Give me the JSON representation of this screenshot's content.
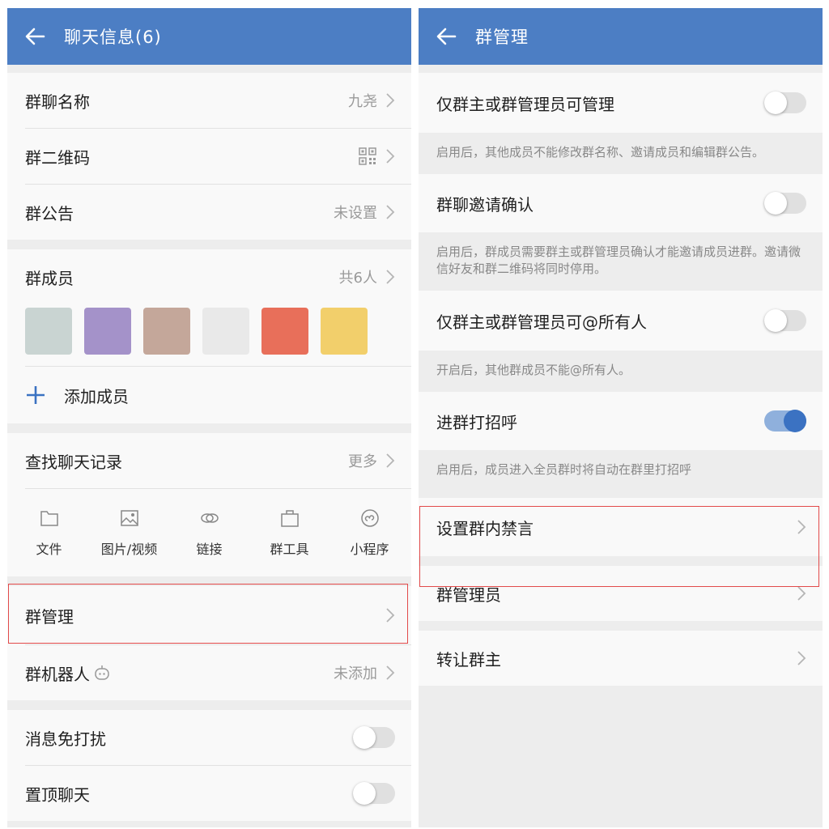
{
  "left": {
    "title": "聊天信息(6)",
    "group_name": {
      "label": "群聊名称",
      "value": "九尧"
    },
    "qrcode": {
      "label": "群二维码"
    },
    "notice": {
      "label": "群公告",
      "value": "未设置"
    },
    "members": {
      "label": "群成员",
      "value": "共6人",
      "add_label": "添加成员",
      "avatar_colors": [
        "#c9d4d2",
        "#a492c9",
        "#c4a79a",
        "#e9e9e9",
        "#e86f5a",
        "#f2cf6b"
      ]
    },
    "search": {
      "label": "查找聊天记录",
      "value": "更多"
    },
    "tools": [
      {
        "label": "文件",
        "icon": "folder-icon"
      },
      {
        "label": "图片/视频",
        "icon": "image-icon"
      },
      {
        "label": "链接",
        "icon": "link-icon"
      },
      {
        "label": "群工具",
        "icon": "toolbox-icon"
      },
      {
        "label": "小程序",
        "icon": "miniprogram-icon"
      }
    ],
    "manage": {
      "label": "群管理"
    },
    "robot": {
      "label": "群机器人",
      "value": "未添加"
    },
    "mute": {
      "label": "消息免打扰",
      "on": false
    },
    "pin": {
      "label": "置顶聊天",
      "on": false
    }
  },
  "right": {
    "title": "群管理",
    "only_admin": {
      "label": "仅群主或群管理员可管理",
      "on": false,
      "desc": "启用后，其他成员不能修改群名称、邀请成员和编辑群公告。"
    },
    "invite_confirm": {
      "label": "群聊邀请确认",
      "on": false,
      "desc": "启用后，群成员需要群主或群管理员确认才能邀请成员进群。邀请微信好友和群二维码将同时停用。"
    },
    "at_all": {
      "label": "仅群主或群管理员可@所有人",
      "on": false,
      "desc": "开启后，其他群成员不能@所有人。"
    },
    "greeting": {
      "label": "进群打招呼",
      "on": true,
      "desc": "启用后，成员进入全员群时将自动在群里打招呼"
    },
    "mute_all": {
      "label": "设置群内禁言"
    },
    "admins": {
      "label": "群管理员"
    },
    "transfer": {
      "label": "转让群主"
    }
  },
  "colors": {
    "accent": "#4c7ec4",
    "toggle_on": "#3b72c2",
    "highlight": "#e24a4a"
  }
}
